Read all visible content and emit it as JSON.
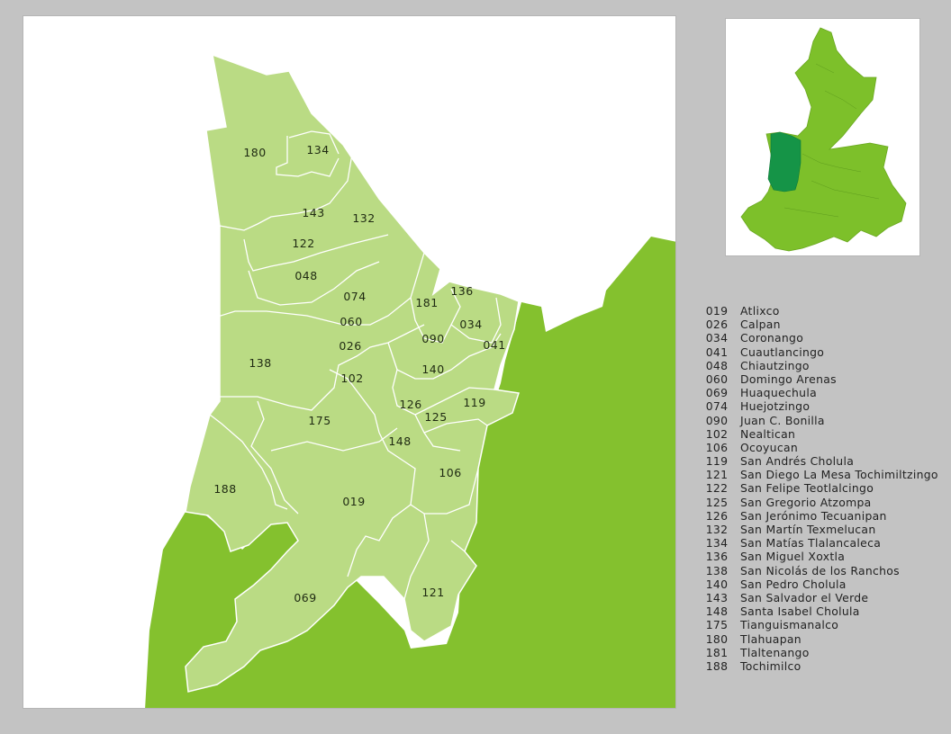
{
  "colors": {
    "background": "#c3c3c3",
    "region_fill": "#badb84",
    "region_border": "#ffffff",
    "surrounding_fill": "#84c12e",
    "state_fill": "#7dc02a",
    "highlight_fill": "#159447"
  },
  "map_labels": [
    {
      "code": "180"
    },
    {
      "code": "134"
    },
    {
      "code": "143"
    },
    {
      "code": "132"
    },
    {
      "code": "122"
    },
    {
      "code": "048"
    },
    {
      "code": "074"
    },
    {
      "code": "181"
    },
    {
      "code": "136"
    },
    {
      "code": "060"
    },
    {
      "code": "034"
    },
    {
      "code": "090"
    },
    {
      "code": "041"
    },
    {
      "code": "026"
    },
    {
      "code": "138"
    },
    {
      "code": "102"
    },
    {
      "code": "140"
    },
    {
      "code": "126"
    },
    {
      "code": "119"
    },
    {
      "code": "125"
    },
    {
      "code": "175"
    },
    {
      "code": "148"
    },
    {
      "code": "106"
    },
    {
      "code": "188"
    },
    {
      "code": "019"
    },
    {
      "code": "069"
    },
    {
      "code": "121"
    }
  ],
  "legend": [
    {
      "code": "019",
      "name": "Atlixco"
    },
    {
      "code": "026",
      "name": "Calpan"
    },
    {
      "code": "034",
      "name": "Coronango"
    },
    {
      "code": "041",
      "name": "Cuautlancingo"
    },
    {
      "code": "048",
      "name": "Chiautzingo"
    },
    {
      "code": "060",
      "name": "Domingo Arenas"
    },
    {
      "code": "069",
      "name": "Huaquechula"
    },
    {
      "code": "074",
      "name": "Huejotzingo"
    },
    {
      "code": "090",
      "name": "Juan C. Bonilla"
    },
    {
      "code": "102",
      "name": "Nealtican"
    },
    {
      "code": "106",
      "name": "Ocoyucan"
    },
    {
      "code": "119",
      "name": "San Andrés Cholula"
    },
    {
      "code": "121",
      "name": "San Diego La Mesa Tochimiltzingo"
    },
    {
      "code": "122",
      "name": "San Felipe Teotlalcingo"
    },
    {
      "code": "125",
      "name": "San Gregorio Atzompa"
    },
    {
      "code": "126",
      "name": "San Jerónimo Tecuanipan"
    },
    {
      "code": "132",
      "name": "San Martín Texmelucan"
    },
    {
      "code": "134",
      "name": "San Matías Tlalancaleca"
    },
    {
      "code": "136",
      "name": "San Miguel Xoxtla"
    },
    {
      "code": "138",
      "name": "San Nicolás de los Ranchos"
    },
    {
      "code": "140",
      "name": "San Pedro Cholula"
    },
    {
      "code": "143",
      "name": "San Salvador el Verde"
    },
    {
      "code": "148",
      "name": "Santa Isabel Cholula"
    },
    {
      "code": "175",
      "name": "Tianguismanalco"
    },
    {
      "code": "180",
      "name": "Tlahuapan"
    },
    {
      "code": "181",
      "name": "Tlaltenango"
    },
    {
      "code": "188",
      "name": "Tochimilco"
    }
  ]
}
